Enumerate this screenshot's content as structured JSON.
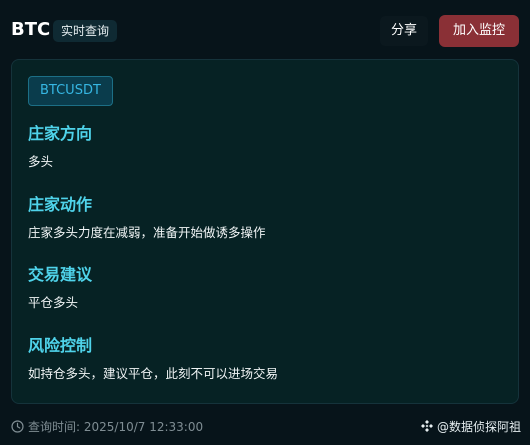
{
  "header": {
    "title": "BTC",
    "tag": "实时查询",
    "share_label": "分享",
    "monitor_label": "加入监控"
  },
  "card": {
    "symbol": "BTCUSDT",
    "sections": [
      {
        "title": "庄家方向",
        "text": "多头"
      },
      {
        "title": "庄家动作",
        "text": "庄家多头力度在减弱，准备开始做诱多操作"
      },
      {
        "title": "交易建议",
        "text": "平仓多头"
      },
      {
        "title": "风险控制",
        "text": "如持仓多头，建议平仓，此刻不可以进场交易"
      }
    ]
  },
  "footer": {
    "query_time": "查询时间: 2025/10/7 12:33:00",
    "brand": "@数据侦探阿祖",
    "time_icon": "clock-icon",
    "brand_icon": "binance-diamond-icon"
  },
  "colors": {
    "accent_title": "#4fd3ea",
    "monitor_button": "#8a3036",
    "symbol_text": "#36b7e3"
  }
}
